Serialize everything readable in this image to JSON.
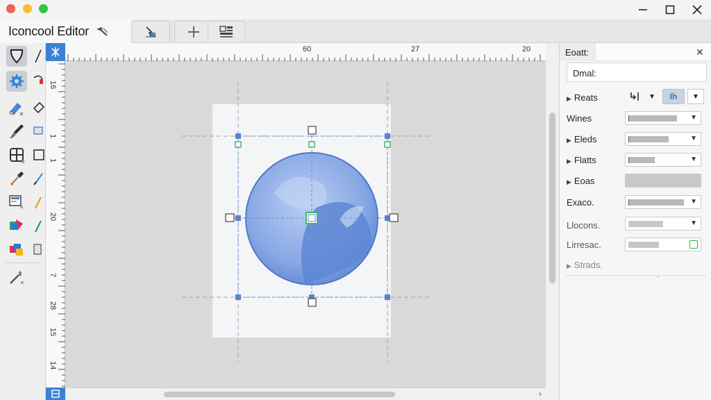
{
  "window": {
    "title": "Iconcool Editor"
  },
  "toolbar": {
    "buttons": [
      {
        "name": "select-arrow-icon"
      },
      {
        "name": "plus-icon"
      },
      {
        "name": "layers-icon"
      }
    ]
  },
  "rulers": {
    "horizontal_numbers": [
      "60",
      "27",
      "20"
    ],
    "vertical_numbers": [
      "16",
      "1",
      "1",
      "20",
      "7",
      "28",
      "15",
      "14"
    ]
  },
  "panel": {
    "tab_label": "Eoatt:",
    "name_value": "Dmal:",
    "rows": [
      {
        "label": "Reats",
        "expandable": true
      },
      {
        "label": "Wines",
        "expandable": false
      },
      {
        "label": "Eleds",
        "expandable": true
      },
      {
        "label": "Flatts",
        "expandable": true
      },
      {
        "label": "Eoas",
        "expandable": true
      },
      {
        "label": "Exaco.",
        "expandable": false
      },
      {
        "label": "Llocons.",
        "expandable": false
      },
      {
        "label": "Lirresac.",
        "expandable": false
      },
      {
        "label": "Strads.",
        "expandable": true
      }
    ],
    "reats_value": "Ih"
  },
  "colors": {
    "accent": "#3b82d6",
    "sphere": "#7fa2e2",
    "handle": "#5a82d0",
    "handle_green": "#3fb86a"
  },
  "icons": {
    "toolbox": [
      "shape-icon",
      "gear-icon",
      "eraser-icon",
      "brush-icon",
      "grid-icon",
      "eyedropper-icon",
      "gradient-icon",
      "fill-icon",
      "layers-color-icon",
      "wand-icon"
    ]
  }
}
